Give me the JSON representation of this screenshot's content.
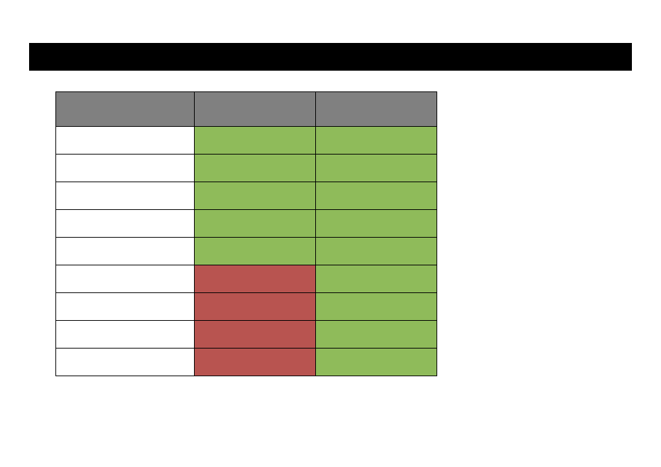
{
  "chart_data": {
    "type": "table",
    "title": "",
    "columns": [
      "",
      "",
      ""
    ],
    "groups": [
      {
        "rows": [
          {
            "label": "",
            "c1": "green",
            "c2": "green"
          },
          {
            "label": "",
            "c1": "green",
            "c2": "green"
          },
          {
            "label": "",
            "c1": "green",
            "c2": "green"
          }
        ]
      },
      {
        "rows": [
          {
            "label": "",
            "c1": "green",
            "c2": "green"
          },
          {
            "label": "",
            "c1": "green",
            "c2": "green"
          }
        ]
      },
      {
        "rows": [
          {
            "label": "",
            "c1": "red",
            "c2": "green"
          },
          {
            "label": "",
            "c1": "red",
            "c2": "green"
          }
        ]
      },
      {
        "rows": [
          {
            "label": "",
            "c1": "red",
            "c2": "green"
          },
          {
            "label": "",
            "c1": "red",
            "c2": "green"
          }
        ]
      }
    ],
    "colors": {
      "green": "#8fbb5a",
      "red": "#b85450",
      "header": "#808080",
      "titlebar": "#000000"
    }
  }
}
